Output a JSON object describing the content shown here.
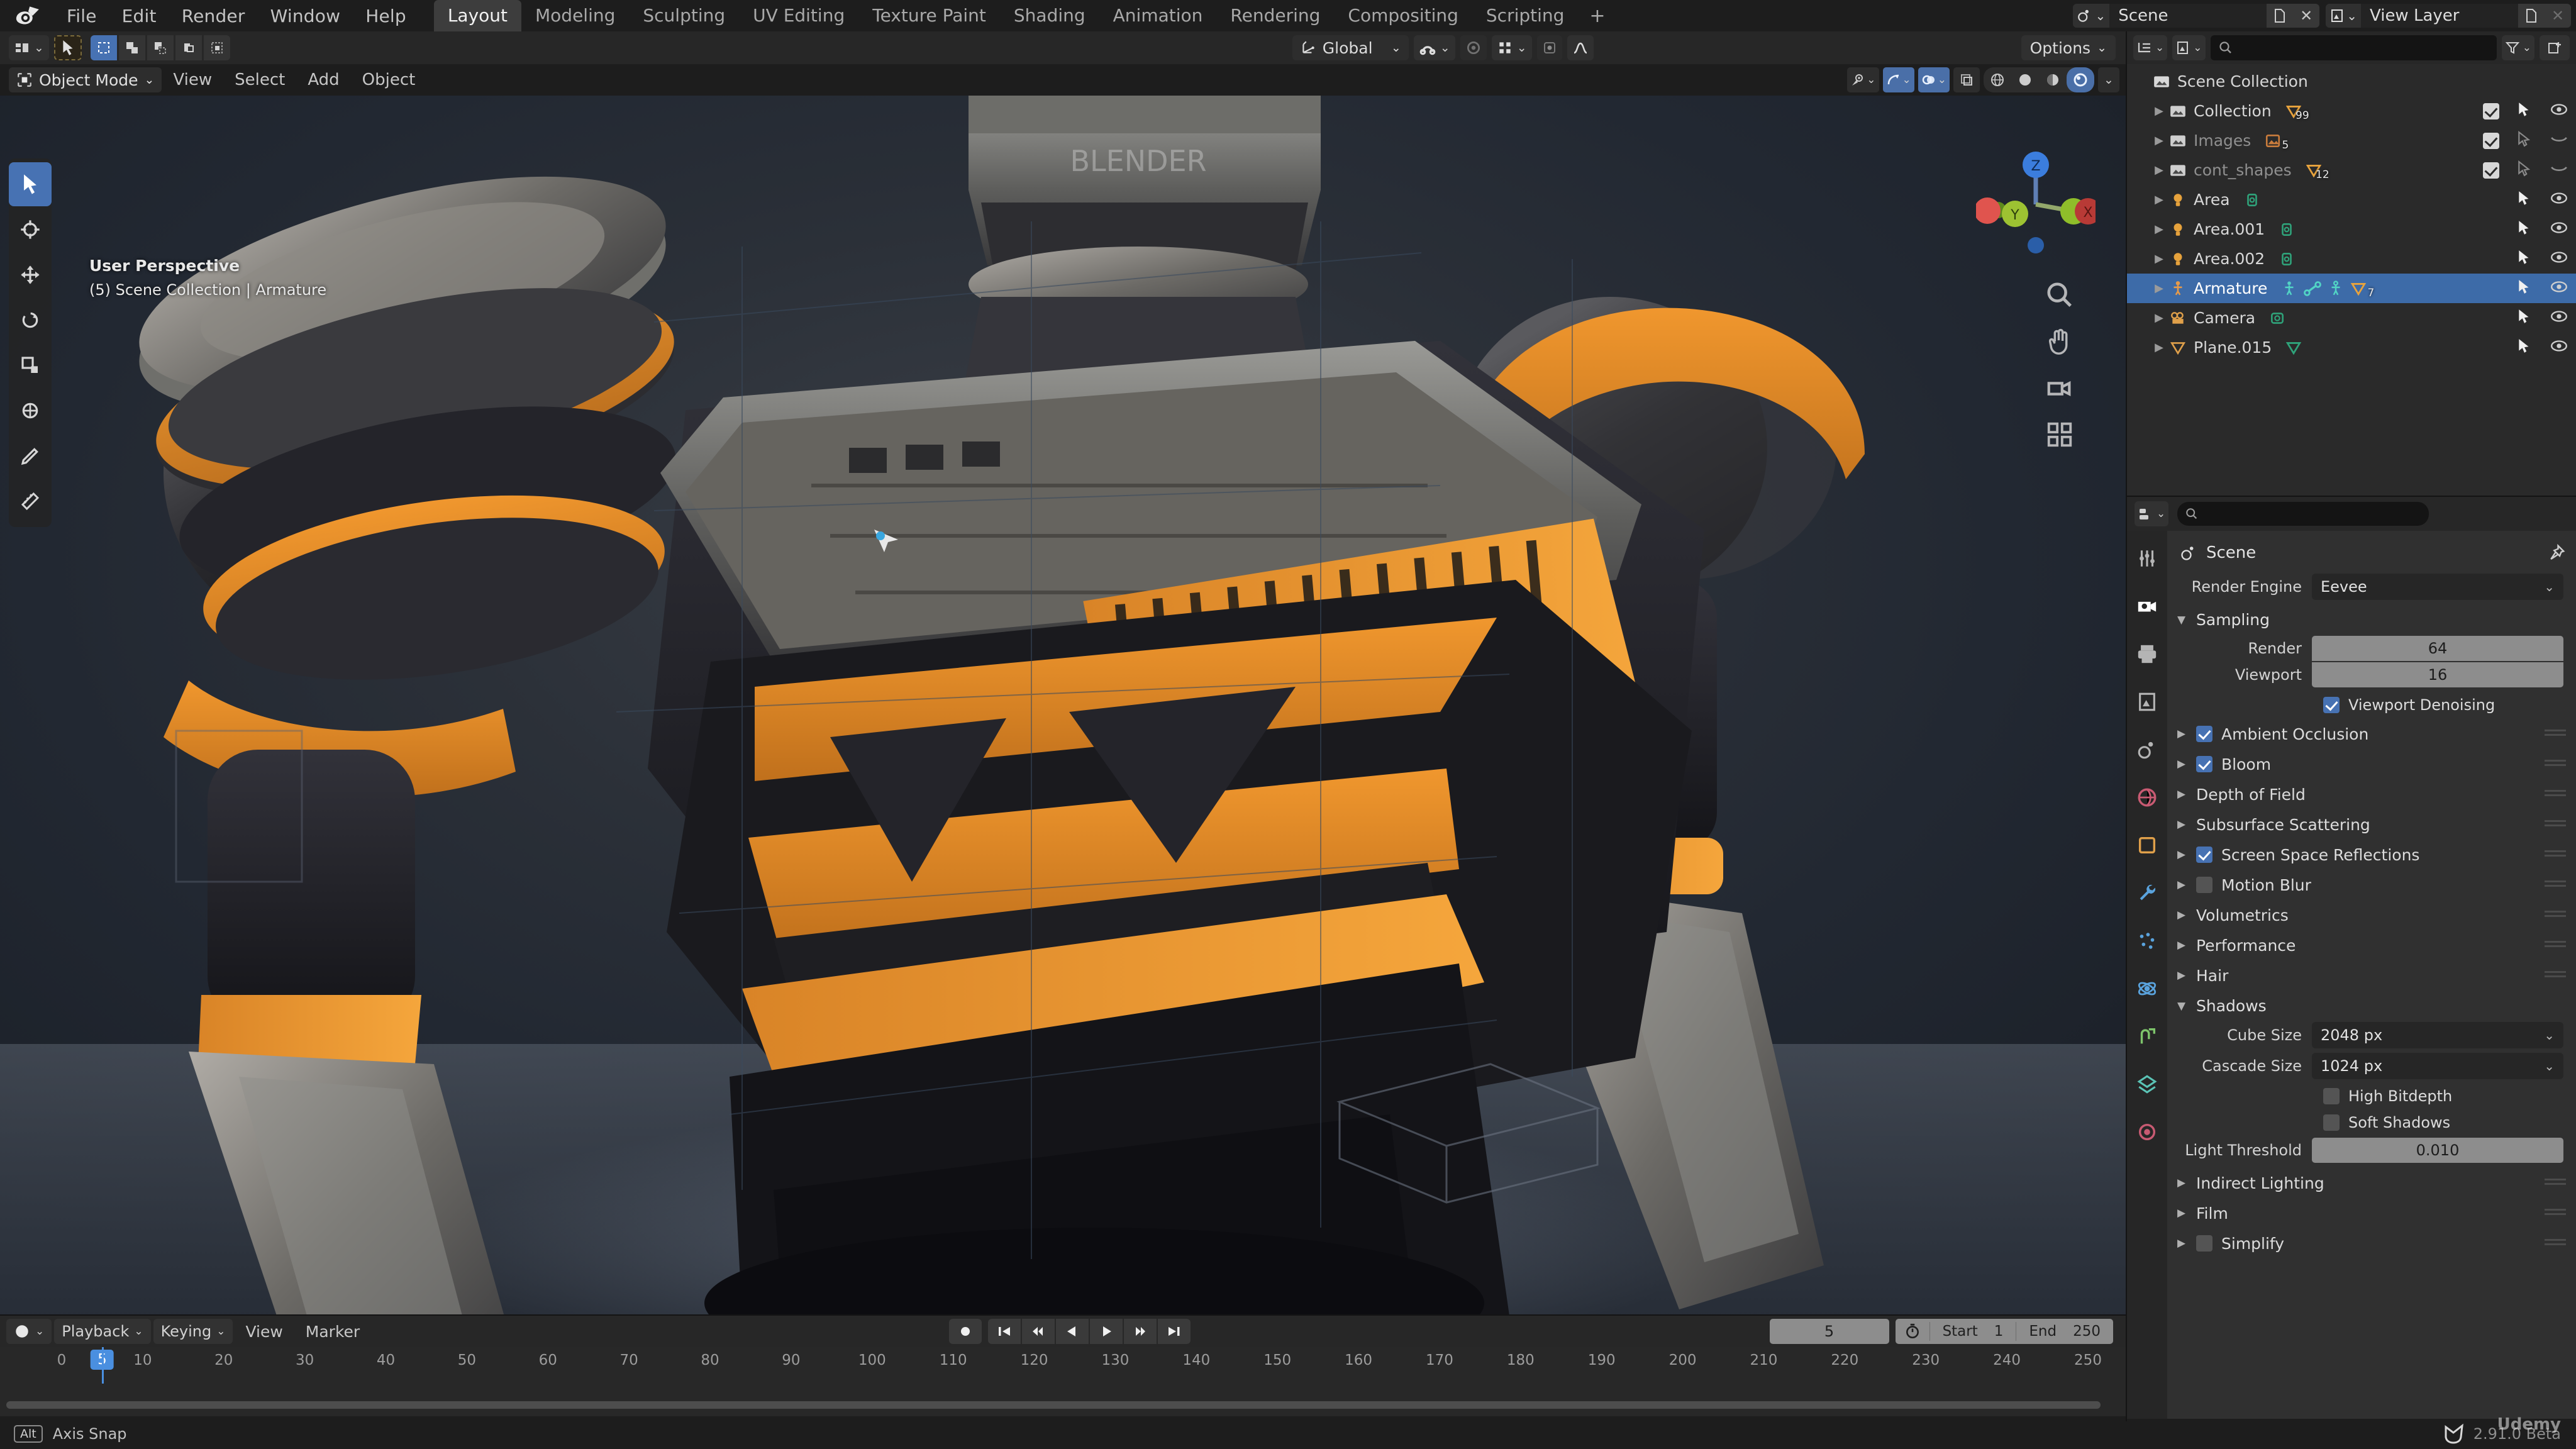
{
  "app": {
    "name": "Blender",
    "version": "2.91.0 Beta",
    "watermark": "Udemy"
  },
  "topbar": {
    "menus": [
      "File",
      "Edit",
      "Render",
      "Window",
      "Help"
    ],
    "workspaces": [
      {
        "label": "Layout",
        "active": true
      },
      {
        "label": "Modeling",
        "active": false
      },
      {
        "label": "Sculpting",
        "active": false
      },
      {
        "label": "UV Editing",
        "active": false
      },
      {
        "label": "Texture Paint",
        "active": false
      },
      {
        "label": "Shading",
        "active": false
      },
      {
        "label": "Animation",
        "active": false
      },
      {
        "label": "Rendering",
        "active": false
      },
      {
        "label": "Compositing",
        "active": false
      },
      {
        "label": "Scripting",
        "active": false
      }
    ],
    "add_workspace_label": "+",
    "scene_name": "Scene",
    "view_layer_name": "View Layer",
    "scene_icon": "scene-icon",
    "view_layer_icon": "view-layer-icon",
    "new_icon": "new-datablock-icon",
    "unlink_icon": "unlink-icon"
  },
  "tool_header": {
    "editor_type_icon": "editor-type-icon",
    "tool_icon": "cursor-tool-icon",
    "select_modes": [
      "select-box-icon",
      "select-difference-icon",
      "select-intersect-icon",
      "select-add-icon",
      "select-subtract-icon"
    ],
    "orientation_label": "Global",
    "orientation_icon": "orientation-axes-icon",
    "snap_icon": "magnet-icon",
    "snap_target_icon": "snap-increment-icon",
    "proportional_edit_icon": "proportional-edit-icon",
    "proportional_falloff_icon": "falloff-smooth-icon",
    "options_label": "Options"
  },
  "viewport_header": {
    "mode_label": "Object Mode",
    "mode_icon": "object-mode-icon",
    "menus": [
      "View",
      "Select",
      "Add",
      "Object"
    ],
    "right_icons": [
      "visibility-icon",
      "gizmo-icon",
      "overlays-icon",
      "xray-icon"
    ],
    "shading_modes": [
      "wireframe-icon",
      "solid-icon",
      "material-preview-icon",
      "rendered-icon"
    ],
    "shading_active_index": 3
  },
  "viewport": {
    "overlay_line1": "User Perspective",
    "overlay_line2": "(5) Scene Collection | Armature",
    "gizmo_axes": [
      {
        "label": "Z",
        "color": "#3b7ddd"
      },
      {
        "label": "Y",
        "color": "#8fbe2a"
      },
      {
        "label": "X",
        "color": "#e0544e"
      }
    ],
    "nav_buttons": [
      "zoom-icon",
      "pan-hand-icon",
      "camera-view-icon",
      "toggle-ortho-icon"
    ],
    "tools": [
      {
        "name": "tweak-tool",
        "active": true
      },
      {
        "name": "cursor-tool",
        "active": false
      },
      {
        "name": "move-tool",
        "active": false
      },
      {
        "name": "rotate-tool",
        "active": false
      },
      {
        "name": "scale-tool",
        "active": false
      },
      {
        "name": "transform-tool",
        "active": false
      },
      {
        "name": "annotate-tool",
        "active": false
      },
      {
        "name": "measure-tool",
        "active": false
      }
    ]
  },
  "outliner": {
    "display_mode_icon": "outliner-display-icon",
    "filter_id_icon": "view-layer-icon",
    "search_placeholder": "",
    "filter_icon": "filter-funnel-icon",
    "new_collection_icon": "new-collection-icon",
    "rows": [
      {
        "label": "Scene Collection",
        "icon": "scene-collection-icon",
        "indent": 0,
        "expandable": false,
        "selected": false,
        "dim": false,
        "checkbox": false,
        "badges": [],
        "arrow": false,
        "eye": false
      },
      {
        "label": "Collection",
        "icon": "collection-icon",
        "indent": 1,
        "expandable": true,
        "selected": false,
        "dim": false,
        "checkbox": true,
        "badges": [
          {
            "icon": "mesh-data-icon",
            "count": "99",
            "color": "#e8a33d"
          }
        ],
        "arrow": true,
        "eye": true
      },
      {
        "label": "Images",
        "icon": "collection-icon",
        "indent": 1,
        "expandable": true,
        "selected": false,
        "dim": true,
        "checkbox": true,
        "badges": [
          {
            "icon": "image-data-icon",
            "count": "5",
            "color": "#c97c3c"
          }
        ],
        "arrow": true,
        "eye": false
      },
      {
        "label": "cont_shapes",
        "icon": "collection-icon",
        "indent": 1,
        "expandable": true,
        "selected": false,
        "dim": true,
        "checkbox": true,
        "badges": [
          {
            "icon": "mesh-data-icon",
            "count": "12",
            "color": "#e8a33d"
          }
        ],
        "arrow": true,
        "eye": false
      },
      {
        "label": "Area",
        "icon": "light-icon",
        "indent": 1,
        "expandable": true,
        "selected": false,
        "dim": false,
        "checkbox": false,
        "badges": [
          {
            "icon": "light-data-icon",
            "count": "",
            "color": "#2fa37a"
          }
        ],
        "arrow": true,
        "eye": true
      },
      {
        "label": "Area.001",
        "icon": "light-icon",
        "indent": 1,
        "expandable": true,
        "selected": false,
        "dim": false,
        "checkbox": false,
        "badges": [
          {
            "icon": "light-data-icon",
            "count": "",
            "color": "#2fa37a"
          }
        ],
        "arrow": true,
        "eye": true
      },
      {
        "label": "Area.002",
        "icon": "light-icon",
        "indent": 1,
        "expandable": true,
        "selected": false,
        "dim": false,
        "checkbox": false,
        "badges": [
          {
            "icon": "light-data-icon",
            "count": "",
            "color": "#2fa37a"
          }
        ],
        "arrow": true,
        "eye": true
      },
      {
        "label": "Armature",
        "icon": "armature-icon",
        "indent": 1,
        "expandable": true,
        "selected": true,
        "dim": false,
        "checkbox": false,
        "badges": [
          {
            "icon": "pose-icon",
            "count": "",
            "color": "#52d4c5"
          },
          {
            "icon": "bone-data-icon",
            "count": "",
            "color": "#52d4c5"
          },
          {
            "icon": "armature-data-icon",
            "count": "",
            "color": "#52d4c5"
          },
          {
            "icon": "mesh-data-icon",
            "count": "7",
            "color": "#e8a33d"
          }
        ],
        "arrow": true,
        "eye": true
      },
      {
        "label": "Camera",
        "icon": "camera-icon",
        "indent": 1,
        "expandable": true,
        "selected": false,
        "dim": false,
        "checkbox": false,
        "badges": [
          {
            "icon": "camera-data-icon",
            "count": "",
            "color": "#2fa37a"
          }
        ],
        "arrow": true,
        "eye": true
      },
      {
        "label": "Plane.015",
        "icon": "mesh-icon",
        "indent": 1,
        "expandable": true,
        "selected": false,
        "dim": false,
        "checkbox": false,
        "badges": [
          {
            "icon": "mesh-data-icon",
            "count": "",
            "color": "#2fa37a"
          }
        ],
        "arrow": true,
        "eye": true
      }
    ]
  },
  "properties": {
    "editor_icon": "properties-editor-icon",
    "search_placeholder": "",
    "breadcrumb_label": "Scene",
    "breadcrumb_icon": "scene-icon",
    "pin_icon": "pin-icon",
    "tabs": [
      {
        "name": "tool-tab",
        "icon": "tool-icon",
        "active": false
      },
      {
        "name": "render-tab",
        "icon": "render-camera-icon",
        "active": true
      },
      {
        "name": "output-tab",
        "icon": "output-printer-icon",
        "active": false
      },
      {
        "name": "view-layer-tab",
        "icon": "view-layer-images-icon",
        "active": false
      },
      {
        "name": "scene-tab",
        "icon": "scene-cone-icon",
        "active": false
      },
      {
        "name": "world-tab",
        "icon": "world-globe-icon",
        "active": false
      },
      {
        "name": "object-tab",
        "icon": "object-square-icon",
        "active": false
      },
      {
        "name": "modifier-tab",
        "icon": "wrench-icon",
        "active": false
      },
      {
        "name": "particles-tab",
        "icon": "particles-icon",
        "active": false
      },
      {
        "name": "physics-tab",
        "icon": "physics-orbit-icon",
        "active": false
      },
      {
        "name": "constraints-tab",
        "icon": "constraints-icon",
        "active": false
      },
      {
        "name": "data-tab",
        "icon": "object-data-icon",
        "active": false
      },
      {
        "name": "material-tab",
        "icon": "material-sphere-icon",
        "active": false
      }
    ],
    "render_engine": {
      "label": "Render Engine",
      "value": "Eevee"
    },
    "sampling": {
      "title": "Sampling",
      "render": {
        "label": "Render",
        "value": "64"
      },
      "viewport": {
        "label": "Viewport",
        "value": "16"
      },
      "viewport_denoising": {
        "label": "Viewport Denoising",
        "checked": true
      }
    },
    "panels": [
      {
        "label": "Ambient Occlusion",
        "checkbox": true,
        "checked": true,
        "open": false
      },
      {
        "label": "Bloom",
        "checkbox": true,
        "checked": true,
        "open": false
      },
      {
        "label": "Depth of Field",
        "checkbox": false,
        "checked": false,
        "open": false
      },
      {
        "label": "Subsurface Scattering",
        "checkbox": false,
        "checked": false,
        "open": false
      },
      {
        "label": "Screen Space Reflections",
        "checkbox": true,
        "checked": true,
        "open": false
      },
      {
        "label": "Motion Blur",
        "checkbox": true,
        "checked": false,
        "open": false
      },
      {
        "label": "Volumetrics",
        "checkbox": false,
        "checked": false,
        "open": false
      },
      {
        "label": "Performance",
        "checkbox": false,
        "checked": false,
        "open": false
      },
      {
        "label": "Hair",
        "checkbox": false,
        "checked": false,
        "open": false
      }
    ],
    "shadows": {
      "title": "Shadows",
      "cube_size": {
        "label": "Cube Size",
        "value": "2048 px"
      },
      "cascade_size": {
        "label": "Cascade Size",
        "value": "1024 px"
      },
      "high_bitdepth": {
        "label": "High Bitdepth",
        "checked": false
      },
      "soft_shadows": {
        "label": "Soft Shadows",
        "checked": false
      },
      "light_threshold": {
        "label": "Light Threshold",
        "value": "0.010"
      }
    },
    "panels_after": [
      {
        "label": "Indirect Lighting",
        "checkbox": false,
        "checked": false
      },
      {
        "label": "Film",
        "checkbox": false,
        "checked": false
      },
      {
        "label": "Simplify",
        "checkbox": true,
        "checked": false
      }
    ]
  },
  "timeline": {
    "editor_icon": "timeline-editor-icon",
    "menus": [
      {
        "label": "Playback",
        "dropdown": true
      },
      {
        "label": "Keying",
        "dropdown": true
      },
      {
        "label": "View",
        "dropdown": false
      },
      {
        "label": "Marker",
        "dropdown": false
      }
    ],
    "auto_key_icon": "record-icon",
    "playback_buttons": [
      "jump-start-icon",
      "prev-keyframe-icon",
      "play-reverse-icon",
      "play-icon",
      "next-keyframe-icon",
      "jump-end-icon"
    ],
    "current_frame": "5",
    "timer_icon": "stopwatch-icon",
    "start_label": "Start",
    "start_value": "1",
    "end_label": "End",
    "end_value": "250",
    "ruler_ticks": [
      "0",
      "10",
      "20",
      "30",
      "40",
      "50",
      "60",
      "70",
      "80",
      "90",
      "100",
      "110",
      "120",
      "130",
      "140",
      "150",
      "160",
      "170",
      "180",
      "190",
      "200",
      "210",
      "220",
      "230",
      "240",
      "250"
    ],
    "playhead_label": "5"
  },
  "statusbar": {
    "key": "Alt",
    "hint": "Axis Snap"
  },
  "colors": {
    "accent_blue": "#4772b3",
    "select_orange": "#e8a33d",
    "panel_bg": "#303030",
    "header_bg": "#272727",
    "editor_bg": "#2a2a2a"
  }
}
